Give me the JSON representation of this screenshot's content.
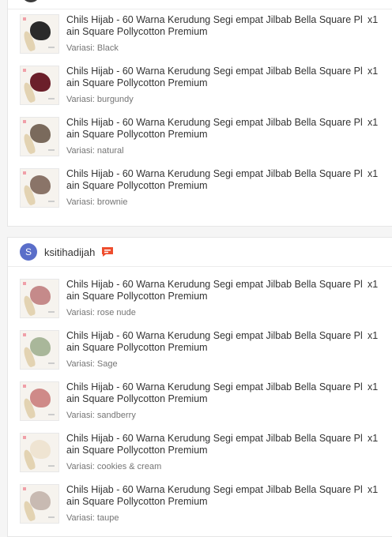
{
  "orders": [
    {
      "items": [
        {
          "title": "Chils Hijab - 60 Warna Kerudung Segi empat Jilbab Bella Square Plain Square Pollycotton Premium",
          "variant": "Variasi: Black",
          "qty": "x1",
          "color": "#2a2a2a"
        },
        {
          "title": "Chils Hijab - 60 Warna Kerudung Segi empat Jilbab Bella Square Plain Square Pollycotton Premium",
          "variant": "Variasi: burgundy",
          "qty": "x1",
          "color": "#6b1f2a"
        },
        {
          "title": "Chils Hijab - 60 Warna Kerudung Segi empat Jilbab Bella Square Plain Square Pollycotton Premium",
          "variant": "Variasi: natural",
          "qty": "x1",
          "color": "#7a6a5c"
        },
        {
          "title": "Chils Hijab - 60 Warna Kerudung Segi empat Jilbab Bella Square Plain Square Pollycotton Premium",
          "variant": "Variasi: brownie",
          "qty": "x1",
          "color": "#8a7468"
        }
      ]
    },
    {
      "shop": {
        "avatar_letter": "S",
        "name": "ksitihadijah",
        "avatar_color": "#5a6ec9",
        "chat_color": "#ee4d2d"
      },
      "items": [
        {
          "title": "Chils Hijab - 60 Warna Kerudung Segi empat Jilbab Bella Square Plain Square Pollycotton Premium",
          "variant": "Variasi: rose nude",
          "qty": "x1",
          "color": "#c58a8a"
        },
        {
          "title": "Chils Hijab - 60 Warna Kerudung Segi empat Jilbab Bella Square Plain Square Pollycotton Premium",
          "variant": "Variasi: Sage",
          "qty": "x1",
          "color": "#a9b79a"
        },
        {
          "title": "Chils Hijab - 60 Warna Kerudung Segi empat Jilbab Bella Square Plain Square Pollycotton Premium",
          "variant": "Variasi: sandberry",
          "qty": "x1",
          "color": "#cf8a88"
        },
        {
          "title": "Chils Hijab - 60 Warna Kerudung Segi empat Jilbab Bella Square Plain Square Pollycotton Premium",
          "variant": "Variasi: cookies & cream",
          "qty": "x1",
          "color": "#efe4d2"
        },
        {
          "title": "Chils Hijab - 60 Warna Kerudung Segi empat Jilbab Bella Square Plain Square Pollycotton Premium",
          "variant": "Variasi: taupe",
          "qty": "x1",
          "color": "#c8bab2"
        }
      ]
    }
  ]
}
